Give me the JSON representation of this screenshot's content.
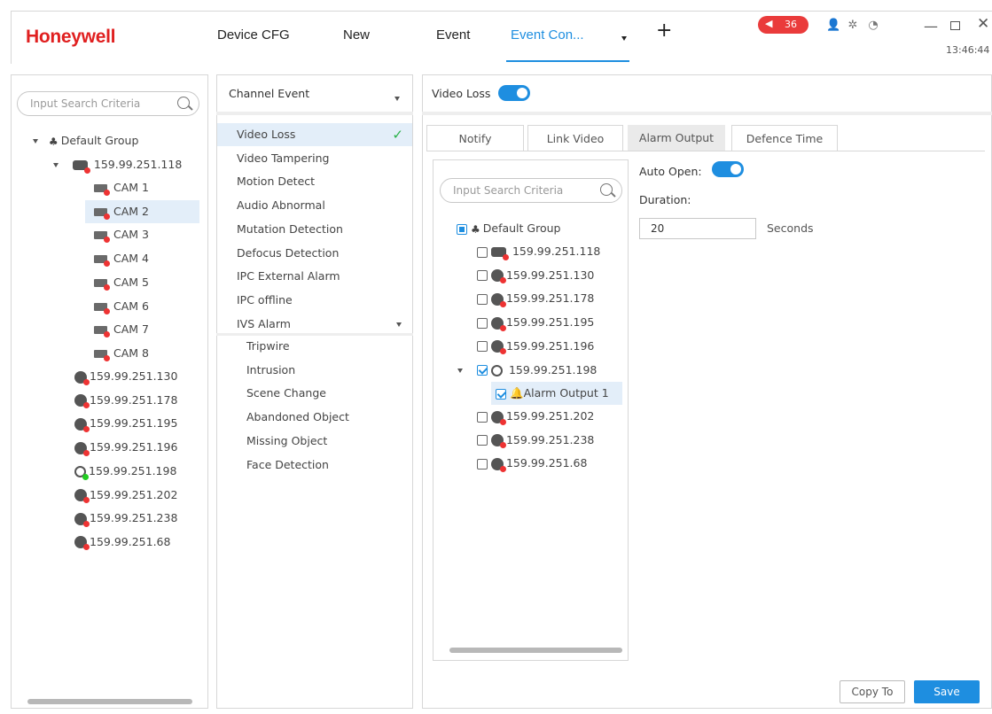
{
  "header": {
    "logo": "Honeywell",
    "tabs": [
      "Device CFG",
      "New",
      "Event",
      "Event Con..."
    ],
    "alarm_count": "36",
    "time": "13:46:44",
    "accent": "#1e8ee0",
    "brand": "#e02020"
  },
  "left": {
    "search_placeholder": "Input Search Criteria",
    "group": "Default Group",
    "nvr": "159.99.251.118",
    "cams": [
      "CAM 1",
      "CAM 2",
      "CAM 3",
      "CAM 4",
      "CAM 5",
      "CAM 6",
      "CAM 7",
      "CAM 8"
    ],
    "devices": [
      "159.99.251.130",
      "159.99.251.178",
      "159.99.251.195",
      "159.99.251.196",
      "159.99.251.198",
      "159.99.251.202",
      "159.99.251.238",
      "159.99.251.68"
    ]
  },
  "events": {
    "dropdown": "Channel Event",
    "items": [
      "Video Loss",
      "Video Tampering",
      "Motion Detect",
      "Audio Abnormal",
      "Mutation Detection",
      "Defocus Detection",
      "IPC External Alarm",
      "IPC offline",
      "IVS Alarm"
    ],
    "ivs": [
      "Tripwire",
      "Intrusion",
      "Scene Change",
      "Abandoned Object",
      "Missing Object",
      "Face Detection"
    ]
  },
  "right": {
    "title": "Video Loss",
    "tabs": [
      "Notify",
      "Link Video",
      "Alarm Output",
      "Defence Time"
    ],
    "search_placeholder": "Input Search Criteria",
    "group": "Default Group",
    "devices": [
      "159.99.251.118",
      "159.99.251.130",
      "159.99.251.178",
      "159.99.251.195",
      "159.99.251.196",
      "159.99.251.198"
    ],
    "alarm_output": "Alarm Output 1",
    "devices2": [
      "159.99.251.202",
      "159.99.251.238",
      "159.99.251.68"
    ],
    "auto_open": "Auto Open:",
    "duration_label": "Duration:",
    "duration": "20",
    "seconds": "Seconds",
    "copy_to": "Copy To",
    "save": "Save"
  }
}
